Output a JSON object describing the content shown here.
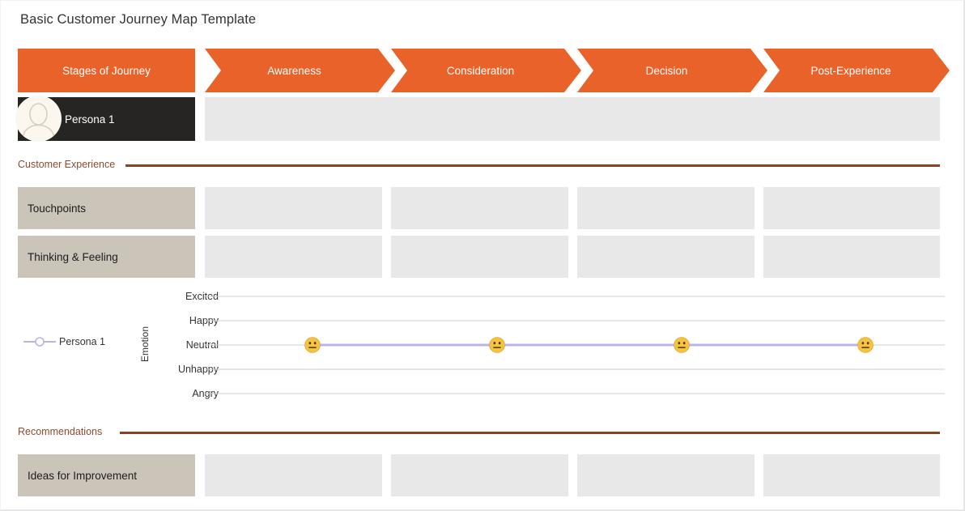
{
  "title": "Basic Customer Journey Map Template",
  "theme": {
    "orange": "#E8622A",
    "dark": "#262524",
    "taupe": "#CBC5B9",
    "cell_gray": "#E8E8E8",
    "section_brown": "#8C4A2E",
    "rule_brown": "#8C3F22",
    "series_lavender": "#B9B4E8",
    "emoji_yellow": "#F5C242"
  },
  "stages": {
    "row_label": "Stages of Journey",
    "items": [
      {
        "label": "Awareness"
      },
      {
        "label": "Consideration"
      },
      {
        "label": "Decision"
      },
      {
        "label": "Post-Experience"
      }
    ]
  },
  "persona_row": {
    "label": "Persona 1",
    "avatar_icon": "person-avatar-icon",
    "cells": [
      "",
      "",
      "",
      ""
    ]
  },
  "sections": [
    {
      "id": "customer-experience",
      "label": "Customer Experience"
    },
    {
      "id": "recommendations",
      "label": "Recommendations"
    }
  ],
  "experience_rows": [
    {
      "label": "Touchpoints",
      "cells": [
        "",
        "",
        "",
        ""
      ]
    },
    {
      "label": "Thinking & Feeling",
      "cells": [
        "",
        "",
        "",
        ""
      ]
    }
  ],
  "recommendation_rows": [
    {
      "label": "Ideas for Improvement",
      "cells": [
        "",
        "",
        "",
        ""
      ]
    }
  ],
  "chart_data": {
    "type": "line",
    "title": "",
    "xlabel": "",
    "ylabel": "Emotion",
    "categories": [
      "Awareness",
      "Consideration",
      "Decision",
      "Post-Experience"
    ],
    "y_tick_labels": [
      "Excited",
      "Happy",
      "Neutral",
      "Unhappy",
      "Angry"
    ],
    "y_levels": [
      5,
      4,
      3,
      2,
      1
    ],
    "ylim": [
      1,
      5
    ],
    "grid": true,
    "legend_position": "left",
    "series": [
      {
        "name": "Persona 1",
        "color": "#B9B4E8",
        "marker": "neutral-face-emoji",
        "values": [
          3,
          3,
          3,
          3
        ],
        "value_labels": [
          "Neutral",
          "Neutral",
          "Neutral",
          "Neutral"
        ]
      }
    ]
  }
}
